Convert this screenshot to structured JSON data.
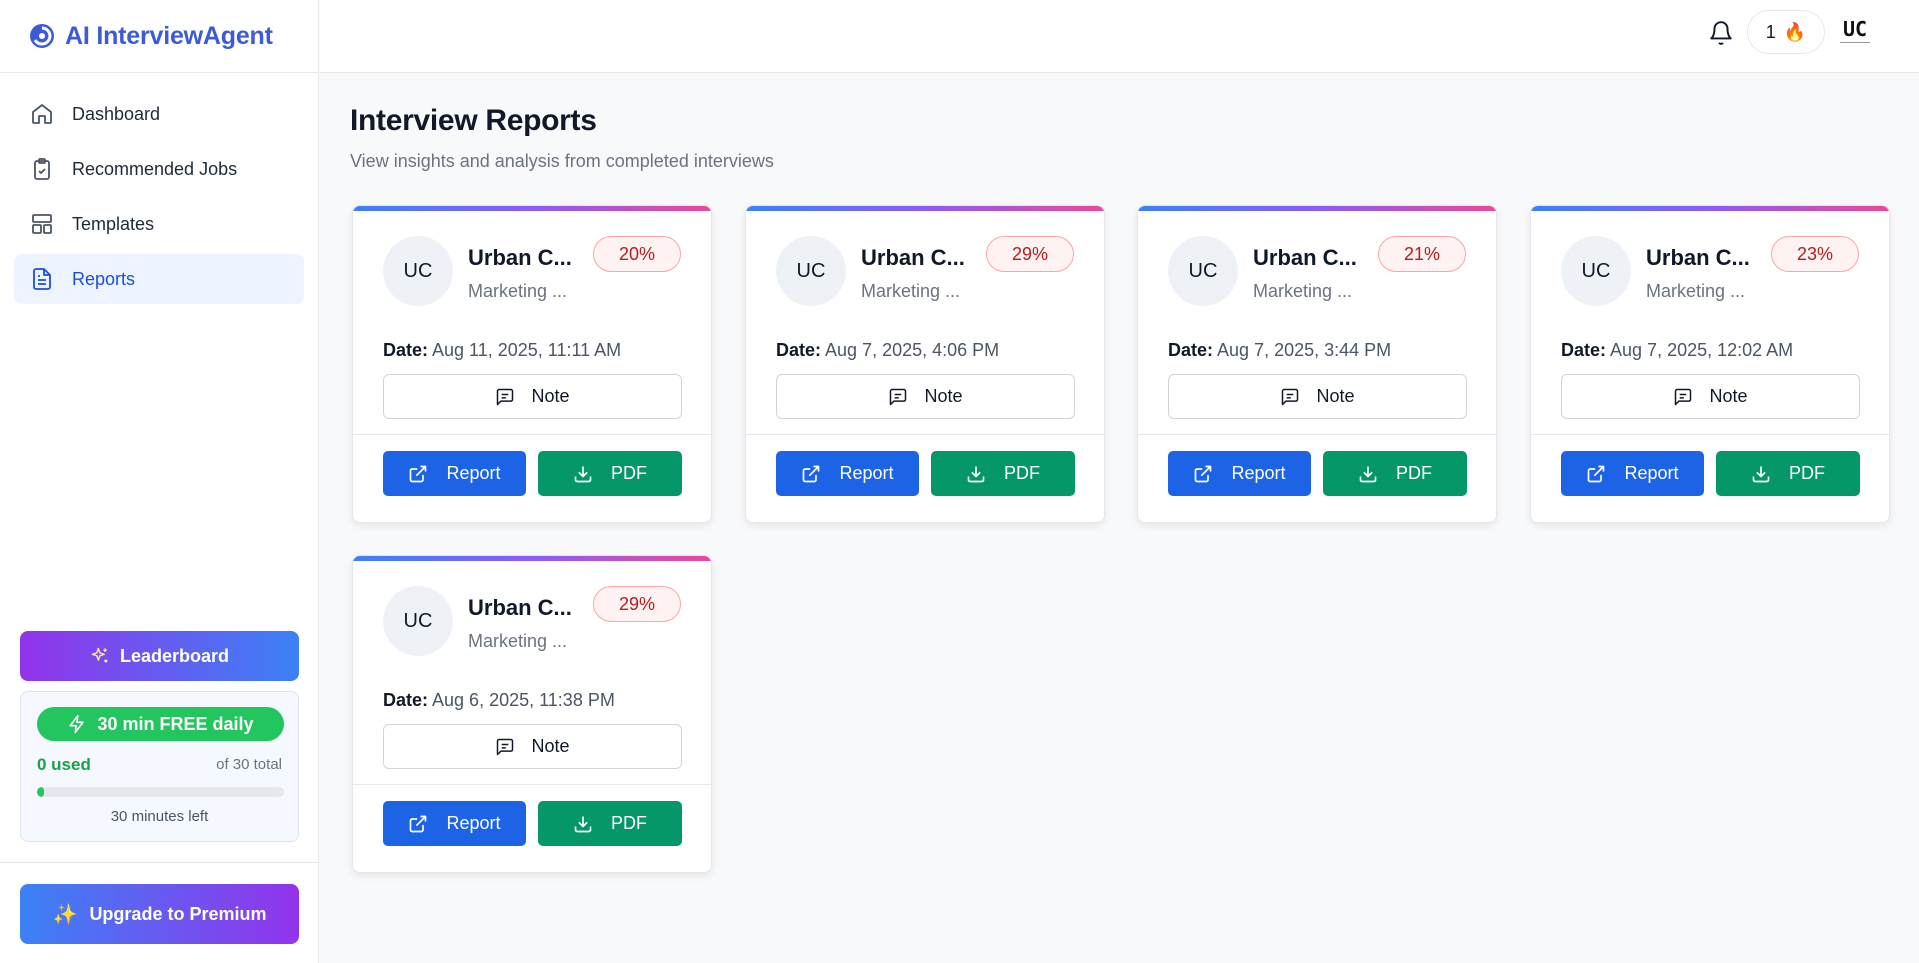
{
  "brand": {
    "name": "AI InterviewAgent"
  },
  "sidebar": {
    "items": [
      {
        "label": "Dashboard",
        "icon": "home-icon",
        "active": false
      },
      {
        "label": "Recommended Jobs",
        "icon": "clipboard-check-icon",
        "active": false
      },
      {
        "label": "Templates",
        "icon": "layout-icon",
        "active": false
      },
      {
        "label": "Reports",
        "icon": "file-text-icon",
        "active": true
      }
    ],
    "leaderboard_label": "Leaderboard",
    "free_daily": {
      "pill_label": "30 min FREE daily",
      "used_label": "0 used",
      "total_label": "of 30 total",
      "progress_fraction": 0.03,
      "remaining_label": "30 minutes left"
    },
    "upgrade_label": "Upgrade to Premium"
  },
  "header": {
    "streak_count": "1",
    "streak_icon": "🔥",
    "avatar_initials": "UC"
  },
  "main": {
    "title": "Interview Reports",
    "subtitle": "View insights and analysis from completed interviews",
    "date_label": "Date:",
    "note_label": "Note",
    "report_label": "Report",
    "pdf_label": "PDF",
    "cards": [
      {
        "initials": "UC",
        "name": "Urban C...",
        "role": "Marketing ...",
        "score": "20%",
        "date": "Aug 11, 2025, 11:11 AM"
      },
      {
        "initials": "UC",
        "name": "Urban C...",
        "role": "Marketing ...",
        "score": "29%",
        "date": "Aug 7, 2025, 4:06 PM"
      },
      {
        "initials": "UC",
        "name": "Urban C...",
        "role": "Marketing ...",
        "score": "21%",
        "date": "Aug 7, 2025, 3:44 PM"
      },
      {
        "initials": "UC",
        "name": "Urban C...",
        "role": "Marketing ...",
        "score": "23%",
        "date": "Aug 7, 2025, 12:02 AM"
      },
      {
        "initials": "UC",
        "name": "Urban C...",
        "role": "Marketing ...",
        "score": "29%",
        "date": "Aug 6, 2025, 11:38 PM"
      }
    ]
  },
  "colors": {
    "primary": "#1d63e6",
    "success": "#059669",
    "brand": "#3b5bdb",
    "score_bg": "#fef2f2",
    "score_text": "#b91c1c"
  }
}
